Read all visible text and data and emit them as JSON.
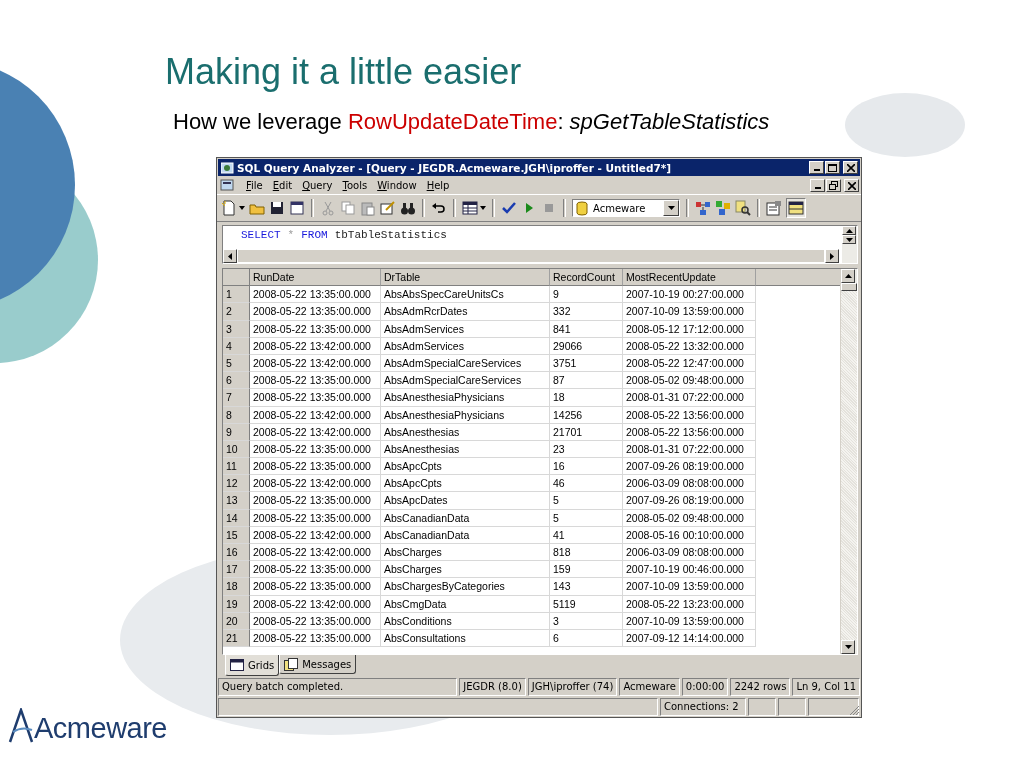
{
  "slide": {
    "title": "Making it a little easier",
    "subtitle_lead": "How we leverage ",
    "subtitle_highlight": "RowUpdateDateTime",
    "subtitle_rest": ": *spGetTableStatistics*",
    "logo": "Acmeware"
  },
  "window": {
    "title": "SQL Query Analyzer - [Query - JEGDR.Acmeware.JGH\\iproffer - Untitled7*]"
  },
  "menu": [
    "File",
    "Edit",
    "Query",
    "Tools",
    "Window",
    "Help"
  ],
  "database_combo": {
    "value": "Acmeware"
  },
  "query": [
    {
      "kind": "keyword",
      "text": "SELECT"
    },
    {
      "kind": "operator",
      "text": "*"
    },
    {
      "kind": "keyword",
      "text": "FROM"
    },
    {
      "kind": "identifier",
      "text": "tbTableStatistics"
    }
  ],
  "results": {
    "columns": [
      "RunDate",
      "DrTable",
      "RecordCount",
      "MostRecentUpdate"
    ],
    "rows": [
      {
        "num": "1",
        "cells": [
          "2008-05-22 13:35:00.000",
          "AbsAbsSpecCareUnitsCs",
          "9",
          "2007-10-19 00:27:00.000"
        ]
      },
      {
        "num": "2",
        "cells": [
          "2008-05-22 13:35:00.000",
          "AbsAdmRcrDates",
          "332",
          "2007-10-09 13:59:00.000"
        ]
      },
      {
        "num": "3",
        "cells": [
          "2008-05-22 13:35:00.000",
          "AbsAdmServices",
          "841",
          "2008-05-12 17:12:00.000"
        ]
      },
      {
        "num": "4",
        "cells": [
          "2008-05-22 13:42:00.000",
          "AbsAdmServices",
          "29066",
          "2008-05-22 13:32:00.000"
        ]
      },
      {
        "num": "5",
        "cells": [
          "2008-05-22 13:42:00.000",
          "AbsAdmSpecialCareServices",
          "3751",
          "2008-05-22 12:47:00.000"
        ]
      },
      {
        "num": "6",
        "cells": [
          "2008-05-22 13:35:00.000",
          "AbsAdmSpecialCareServices",
          "87",
          "2008-05-02 09:48:00.000"
        ]
      },
      {
        "num": "7",
        "cells": [
          "2008-05-22 13:35:00.000",
          "AbsAnesthesiaPhysicians",
          "18",
          "2008-01-31 07:22:00.000"
        ]
      },
      {
        "num": "8",
        "cells": [
          "2008-05-22 13:42:00.000",
          "AbsAnesthesiaPhysicians",
          "14256",
          "2008-05-22 13:56:00.000"
        ]
      },
      {
        "num": "9",
        "cells": [
          "2008-05-22 13:42:00.000",
          "AbsAnesthesias",
          "21701",
          "2008-05-22 13:56:00.000"
        ]
      },
      {
        "num": "10",
        "cells": [
          "2008-05-22 13:35:00.000",
          "AbsAnesthesias",
          "23",
          "2008-01-31 07:22:00.000"
        ]
      },
      {
        "num": "11",
        "cells": [
          "2008-05-22 13:35:00.000",
          "AbsApcCpts",
          "16",
          "2007-09-26 08:19:00.000"
        ]
      },
      {
        "num": "12",
        "cells": [
          "2008-05-22 13:42:00.000",
          "AbsApcCpts",
          "46",
          "2006-03-09 08:08:00.000"
        ]
      },
      {
        "num": "13",
        "cells": [
          "2008-05-22 13:35:00.000",
          "AbsApcDates",
          "5",
          "2007-09-26 08:19:00.000"
        ]
      },
      {
        "num": "14",
        "cells": [
          "2008-05-22 13:35:00.000",
          "AbsCanadianData",
          "5",
          "2008-05-02 09:48:00.000"
        ]
      },
      {
        "num": "15",
        "cells": [
          "2008-05-22 13:42:00.000",
          "AbsCanadianData",
          "41",
          "2008-05-16 00:10:00.000"
        ]
      },
      {
        "num": "16",
        "cells": [
          "2008-05-22 13:42:00.000",
          "AbsCharges",
          "818",
          "2006-03-09 08:08:00.000"
        ]
      },
      {
        "num": "17",
        "cells": [
          "2008-05-22 13:35:00.000",
          "AbsCharges",
          "159",
          "2007-10-19 00:46:00.000"
        ]
      },
      {
        "num": "18",
        "cells": [
          "2008-05-22 13:35:00.000",
          "AbsChargesByCategories",
          "143",
          "2007-10-09 13:59:00.000"
        ]
      },
      {
        "num": "19",
        "cells": [
          "2008-05-22 13:42:00.000",
          "AbsCmgData",
          "5119",
          "2008-05-22 13:23:00.000"
        ]
      },
      {
        "num": "20",
        "cells": [
          "2008-05-22 13:35:00.000",
          "AbsConditions",
          "3",
          "2007-10-09 13:59:00.000"
        ]
      },
      {
        "num": "21",
        "cells": [
          "2008-05-22 13:35:00.000",
          "AbsConsultations",
          "6",
          "2007-09-12 14:14:00.000"
        ]
      }
    ]
  },
  "result_tabs": [
    {
      "label": "Grids",
      "selected": true
    },
    {
      "label": "Messages",
      "selected": false
    }
  ],
  "status_bar": [
    "Query batch completed.",
    "JEGDR (8.0)",
    "JGH\\iproffer (74)",
    "Acmeware",
    "0:00:00",
    "2242 rows",
    "Ln 9, Col 11"
  ],
  "connections": "Connections: 2"
}
